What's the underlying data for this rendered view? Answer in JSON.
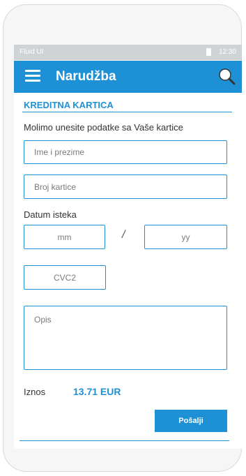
{
  "status_bar": {
    "app_name": "Fluid UI",
    "time": "12:30"
  },
  "app_bar": {
    "title": "Narudžba",
    "menu_icon": "hamburger-menu-icon",
    "search_icon": "search-icon"
  },
  "form": {
    "section_title": "KREDITNA KARTICA",
    "instructions": "Molimo unesite podatke sa Vaše kartice",
    "name_placeholder": "Ime i prezime",
    "card_number_placeholder": "Broj kartice",
    "expiry_label": "Datum isteka",
    "month_placeholder": "mm",
    "separator": "/",
    "year_placeholder": "yy",
    "cvc_placeholder": "CVC2",
    "description_placeholder": "Opis",
    "amount_label": "Iznos",
    "amount_value": "13.71 EUR",
    "submit_label": "Pošalji"
  },
  "colors": {
    "accent": "#1e90d6",
    "status_bar": "#cfd3d6"
  }
}
